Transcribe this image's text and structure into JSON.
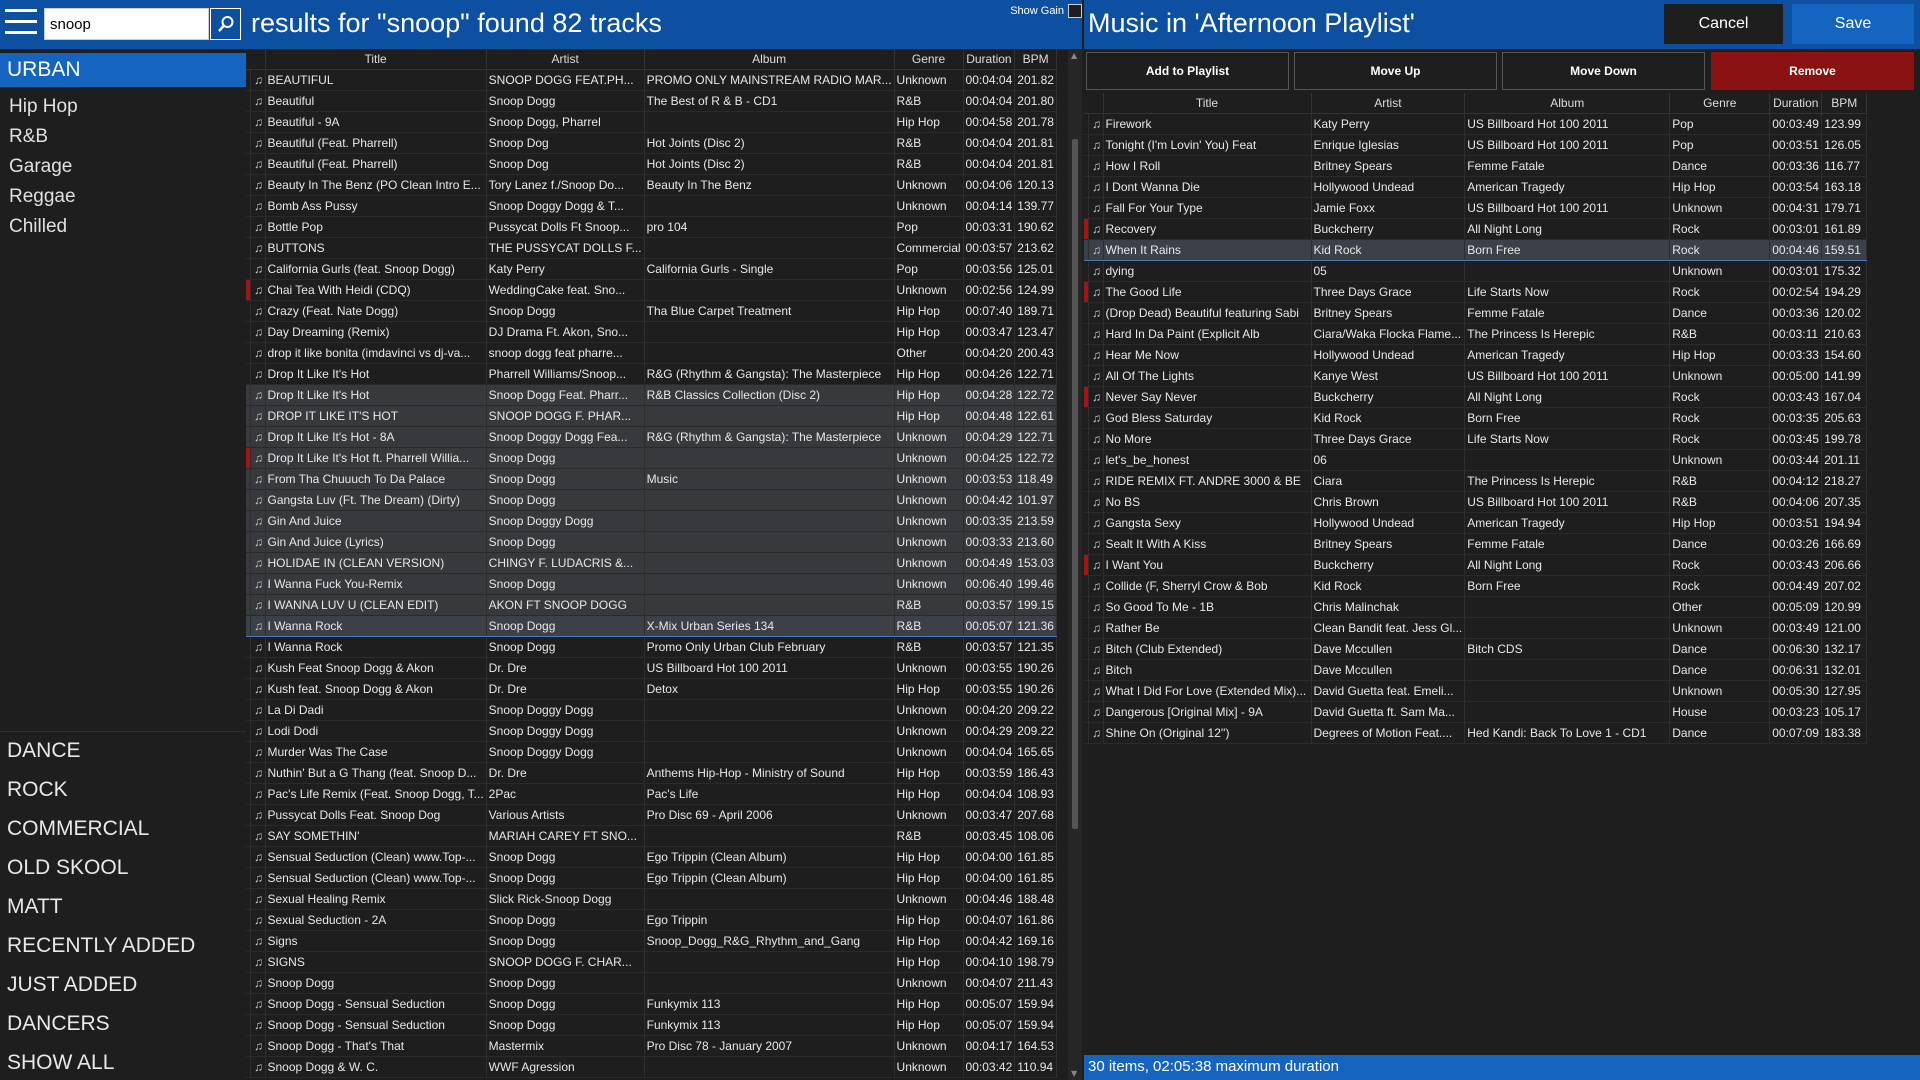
{
  "sidebar": {
    "search_value": "snoop",
    "active_category": "URBAN",
    "subcategories": [
      "Hip Hop",
      "R&B",
      "Garage",
      "Reggae",
      "Chilled"
    ],
    "bottom_categories": [
      "DANCE",
      "ROCK",
      "COMMERCIAL",
      "OLD SKOOL",
      "MATT",
      "RECENTLY ADDED",
      "JUST ADDED",
      "DANCERS",
      "SHOW ALL"
    ]
  },
  "results": {
    "title": "results for \"snoop\" found 82 tracks",
    "show_gain_label": "Show Gain",
    "columns": [
      "Title",
      "Artist",
      "Album",
      "Genre",
      "Duration",
      "BPM"
    ],
    "rows": [
      {
        "title": "BEAUTIFUL",
        "artist": "SNOOP DOGG FEAT.PH...",
        "album": "PROMO ONLY MAINSTREAM  RADIO MAR...",
        "genre": "Unknown",
        "duration": "00:04:04",
        "bpm": "201.82"
      },
      {
        "title": "Beautiful",
        "artist": "Snoop Dogg",
        "album": "The Best of R & B - CD1",
        "genre": "R&B",
        "duration": "00:04:04",
        "bpm": "201.80"
      },
      {
        "title": "Beautiful - 9A",
        "artist": "Snoop Dogg, Pharrel",
        "album": "",
        "genre": "Hip Hop",
        "duration": "00:04:58",
        "bpm": "201.78"
      },
      {
        "title": "Beautiful (Feat. Pharrell)",
        "artist": "Snoop Dog",
        "album": "Hot Joints (Disc 2)",
        "genre": "R&B",
        "duration": "00:04:04",
        "bpm": "201.81"
      },
      {
        "title": "Beautiful (Feat. Pharrell)",
        "artist": "Snoop Dog",
        "album": "Hot Joints (Disc 2)",
        "genre": "R&B",
        "duration": "00:04:04",
        "bpm": "201.81"
      },
      {
        "title": "Beauty In The Benz (PO Clean Intro E...",
        "artist": "Tory Lanez f./Snoop Do...",
        "album": "Beauty In The Benz",
        "genre": "Unknown",
        "duration": "00:04:06",
        "bpm": "120.13"
      },
      {
        "title": "Bomb Ass Pussy",
        "artist": "Snoop Doggy Dogg & T...",
        "album": "",
        "genre": "Unknown",
        "duration": "00:04:14",
        "bpm": "139.77"
      },
      {
        "title": "Bottle Pop",
        "artist": "Pussycat Dolls Ft Snoop...",
        "album": "pro 104",
        "genre": "Pop",
        "duration": "00:03:31",
        "bpm": "190.62"
      },
      {
        "title": "BUTTONS",
        "artist": "THE PUSSYCAT DOLLS F...",
        "album": "",
        "genre": "Commercial",
        "duration": "00:03:57",
        "bpm": "213.62"
      },
      {
        "title": "California Gurls (feat. Snoop Dogg)",
        "artist": "Katy Perry",
        "album": "California Gurls - Single",
        "genre": "Pop",
        "duration": "00:03:56",
        "bpm": "125.01"
      },
      {
        "title": "Chai Tea With Heidi (CDQ)",
        "artist": "WeddingCake  feat. Sno...",
        "album": "",
        "genre": "Unknown",
        "duration": "00:02:56",
        "bpm": "124.99",
        "mark": "red"
      },
      {
        "title": "Crazy (Feat. Nate Dogg)",
        "artist": "Snoop Dogg",
        "album": "Tha Blue Carpet Treatment",
        "genre": "Hip Hop",
        "duration": "00:07:40",
        "bpm": "189.71"
      },
      {
        "title": "Day Dreaming (Remix)",
        "artist": "DJ Drama  Ft. Akon, Sno...",
        "album": "",
        "genre": "Hip Hop",
        "duration": "00:03:47",
        "bpm": "123.47"
      },
      {
        "title": "drop it like bonita (imdavinci vs dj-va...",
        "artist": "snoop dogg feat pharre...",
        "album": "",
        "genre": "Other",
        "duration": "00:04:20",
        "bpm": "200.43"
      },
      {
        "title": "Drop It Like It's Hot",
        "artist": "Pharrell  Williams/Snoop...",
        "album": "R&G (Rhythm & Gangsta): The Masterpiece",
        "genre": "Hip Hop",
        "duration": "00:04:26",
        "bpm": "122.71"
      },
      {
        "title": "Drop It Like It's Hot",
        "artist": "Snoop Dogg Feat. Pharr...",
        "album": "R&B Classics Collection (Disc 2)",
        "genre": "Hip Hop",
        "duration": "00:04:28",
        "bpm": "122.72",
        "sel": true
      },
      {
        "title": "DROP IT LIKE IT'S HOT",
        "artist": "SNOOP DOGG F. PHAR...",
        "album": "",
        "genre": "Hip Hop",
        "duration": "00:04:48",
        "bpm": "122.61",
        "sel": true
      },
      {
        "title": "Drop It Like It's Hot - 8A",
        "artist": "Snoop Doggy Dogg Fea...",
        "album": "R&G (Rhythm & Gangsta): The Masterpiece",
        "genre": "Unknown",
        "duration": "00:04:29",
        "bpm": "122.71",
        "sel": true
      },
      {
        "title": "Drop It Like It's Hot ft. Pharrell Willia...",
        "artist": "Snoop Dogg",
        "album": "",
        "genre": "Unknown",
        "duration": "00:04:25",
        "bpm": "122.72",
        "sel": true,
        "mark": "red"
      },
      {
        "title": "From Tha Chuuuch To Da Palace",
        "artist": "Snoop Dogg",
        "album": "Music",
        "genre": "Unknown",
        "duration": "00:03:53",
        "bpm": "118.49",
        "sel": true
      },
      {
        "title": "Gangsta Luv (Ft. The Dream) (Dirty)",
        "artist": "Snoop Dogg",
        "album": "",
        "genre": "Unknown",
        "duration": "00:04:42",
        "bpm": "101.97",
        "sel": true
      },
      {
        "title": "Gin And Juice",
        "artist": "Snoop Doggy Dogg",
        "album": "",
        "genre": "Unknown",
        "duration": "00:03:35",
        "bpm": "213.59",
        "sel": true
      },
      {
        "title": "Gin And Juice (Lyrics)",
        "artist": "Snoop Dogg",
        "album": "",
        "genre": "Unknown",
        "duration": "00:03:33",
        "bpm": "213.60",
        "sel": true
      },
      {
        "title": "HOLIDAE IN (CLEAN VERSION)",
        "artist": "CHINGY F. LUDACRIS &...",
        "album": "",
        "genre": "Unknown",
        "duration": "00:04:49",
        "bpm": "153.03",
        "sel": true
      },
      {
        "title": "I Wanna Fuck You-Remix",
        "artist": "Snoop Dogg",
        "album": "",
        "genre": "Unknown",
        "duration": "00:06:40",
        "bpm": "199.46",
        "sel": true
      },
      {
        "title": "I WANNA LUV U (CLEAN EDIT)",
        "artist": "AKON FT SNOOP DOGG",
        "album": "",
        "genre": "R&B",
        "duration": "00:03:57",
        "bpm": "199.15",
        "sel": true
      },
      {
        "title": "I Wanna Rock",
        "artist": "Snoop Dogg",
        "album": "X-Mix Urban Series 134",
        "genre": "R&B",
        "duration": "00:05:07",
        "bpm": "121.36",
        "hl": true
      },
      {
        "title": "I Wanna Rock",
        "artist": "Snoop Dogg",
        "album": "Promo Only Urban Club February",
        "genre": "R&B",
        "duration": "00:03:57",
        "bpm": "121.35"
      },
      {
        "title": "Kush Feat Snoop Dogg & Akon",
        "artist": "Dr. Dre",
        "album": "US Billboard Hot 100 2011",
        "genre": "Unknown",
        "duration": "00:03:55",
        "bpm": "190.26"
      },
      {
        "title": "Kush feat. Snoop Dogg & Akon",
        "artist": "Dr. Dre",
        "album": "Detox",
        "genre": "Hip Hop",
        "duration": "00:03:55",
        "bpm": "190.26"
      },
      {
        "title": "La Di Dadi",
        "artist": "Snoop Doggy Dogg",
        "album": "",
        "genre": "Unknown",
        "duration": "00:04:20",
        "bpm": "209.22"
      },
      {
        "title": "Lodi Dodi",
        "artist": "Snoop Doggy Dogg",
        "album": "",
        "genre": "Unknown",
        "duration": "00:04:29",
        "bpm": "209.22"
      },
      {
        "title": "Murder Was The Case",
        "artist": "Snoop Doggy Dogg",
        "album": "",
        "genre": "Unknown",
        "duration": "00:04:04",
        "bpm": "165.65"
      },
      {
        "title": "Nuthin' But a G Thang (feat. Snoop D...",
        "artist": "Dr. Dre",
        "album": "Anthems Hip-Hop - Ministry of Sound",
        "genre": "Hip Hop",
        "duration": "00:03:59",
        "bpm": "186.43"
      },
      {
        "title": "Pac's Life Remix (Feat. Snoop Dogg, T...",
        "artist": "2Pac",
        "album": "Pac's Life",
        "genre": "Hip Hop",
        "duration": "00:04:04",
        "bpm": "108.93"
      },
      {
        "title": "Pussycat Dolls Feat. Snoop Dog",
        "artist": "Various Artists",
        "album": "Pro Disc 69 - April 2006",
        "genre": "Unknown",
        "duration": "00:03:47",
        "bpm": "207.68"
      },
      {
        "title": "SAY SOMETHIN'",
        "artist": "MARIAH CAREY FT SNO...",
        "album": "",
        "genre": "R&B",
        "duration": "00:03:45",
        "bpm": "108.06"
      },
      {
        "title": "Sensual Seduction (Clean) www.Top-...",
        "artist": "Snoop Dogg",
        "album": "Ego Trippin (Clean Album)",
        "genre": "Hip Hop",
        "duration": "00:04:00",
        "bpm": "161.85"
      },
      {
        "title": "Sensual Seduction (Clean) www.Top-...",
        "artist": "Snoop Dogg",
        "album": "Ego Trippin (Clean Album)",
        "genre": "Hip Hop",
        "duration": "00:04:00",
        "bpm": "161.85"
      },
      {
        "title": "Sexual Healing Remix",
        "artist": "Slick Rick-Snoop Dogg",
        "album": "",
        "genre": "Unknown",
        "duration": "00:04:46",
        "bpm": "188.48"
      },
      {
        "title": "Sexual Seduction - 2A",
        "artist": "Snoop Dogg",
        "album": "Ego Trippin",
        "genre": "Hip Hop",
        "duration": "00:04:07",
        "bpm": "161.86"
      },
      {
        "title": "Signs",
        "artist": "Snoop Dogg",
        "album": "Snoop_Dogg_R&G_Rhythm_and_Gang",
        "genre": "Hip Hop",
        "duration": "00:04:42",
        "bpm": "169.16"
      },
      {
        "title": "SIGNS",
        "artist": "SNOOP DOGG F. CHAR...",
        "album": "",
        "genre": "Hip Hop",
        "duration": "00:04:10",
        "bpm": "198.79"
      },
      {
        "title": "Snoop Dogg",
        "artist": "Snoop Dogg",
        "album": "",
        "genre": "Unknown",
        "duration": "00:04:07",
        "bpm": "211.43"
      },
      {
        "title": "Snoop Dogg - Sensual Seduction",
        "artist": "Snoop Dogg",
        "album": "Funkymix 113",
        "genre": "Hip Hop",
        "duration": "00:05:07",
        "bpm": "159.94"
      },
      {
        "title": "Snoop Dogg - Sensual Seduction",
        "artist": "Snoop Dogg",
        "album": "Funkymix 113",
        "genre": "Hip Hop",
        "duration": "00:05:07",
        "bpm": "159.94"
      },
      {
        "title": "Snoop Dogg - That's That",
        "artist": "Mastermix",
        "album": "Pro Disc 78 - January 2007",
        "genre": "Unknown",
        "duration": "00:04:17",
        "bpm": "164.53"
      },
      {
        "title": "Snoop Dogg & W. C.",
        "artist": "WWF Agression",
        "album": "",
        "genre": "Unknown",
        "duration": "00:03:42",
        "bpm": "110.94"
      }
    ]
  },
  "playlist": {
    "title": "Music in 'Afternoon Playlist'",
    "cancel_label": "Cancel",
    "save_label": "Save",
    "actions": {
      "add": "Add to Playlist",
      "up": "Move Up",
      "down": "Move Down",
      "remove": "Remove"
    },
    "columns": [
      "Title",
      "Artist",
      "Album",
      "Genre",
      "Duration",
      "BPM"
    ],
    "rows": [
      {
        "title": "Firework",
        "artist": "Katy Perry",
        "album": "US Billboard Hot 100 2011",
        "genre": "Pop",
        "duration": "00:03:49",
        "bpm": "123.99"
      },
      {
        "title": "Tonight (I'm Lovin' You) Feat",
        "artist": "Enrique Iglesias",
        "album": "US Billboard Hot 100 2011",
        "genre": "Pop",
        "duration": "00:03:51",
        "bpm": "126.05"
      },
      {
        "title": "How I Roll",
        "artist": "Britney Spears",
        "album": "Femme Fatale",
        "genre": "Dance",
        "duration": "00:03:36",
        "bpm": "116.77"
      },
      {
        "title": "I Dont Wanna Die",
        "artist": "Hollywood Undead",
        "album": "American Tragedy",
        "genre": "Hip Hop",
        "duration": "00:03:54",
        "bpm": "163.18"
      },
      {
        "title": "Fall For Your Type",
        "artist": "Jamie Foxx",
        "album": "US Billboard Hot 100 2011",
        "genre": "Unknown",
        "duration": "00:04:31",
        "bpm": "179.71"
      },
      {
        "title": "Recovery",
        "artist": "Buckcherry",
        "album": "All Night Long",
        "genre": "Rock",
        "duration": "00:03:01",
        "bpm": "161.89",
        "mark": "red"
      },
      {
        "title": "When It Rains",
        "artist": "Kid Rock",
        "album": "Born Free",
        "genre": "Rock",
        "duration": "00:04:46",
        "bpm": "159.51",
        "hl": true
      },
      {
        "title": "dying",
        "artist": "05",
        "album": "",
        "genre": "Unknown",
        "duration": "00:03:01",
        "bpm": "175.32"
      },
      {
        "title": "The Good Life",
        "artist": "Three Days Grace",
        "album": "Life Starts Now",
        "genre": "Rock",
        "duration": "00:02:54",
        "bpm": "194.29",
        "mark": "red"
      },
      {
        "title": "(Drop Dead) Beautiful featuring Sabi",
        "artist": "Britney Spears",
        "album": "Femme Fatale",
        "genre": "Dance",
        "duration": "00:03:36",
        "bpm": "120.02"
      },
      {
        "title": "Hard In Da Paint (Explicit Alb",
        "artist": "Ciara/Waka Flocka Flame...",
        "album": "The Princess Is Herepic",
        "genre": "R&B",
        "duration": "00:03:11",
        "bpm": "210.63"
      },
      {
        "title": "Hear Me Now",
        "artist": "Hollywood Undead",
        "album": "American Tragedy",
        "genre": "Hip Hop",
        "duration": "00:03:33",
        "bpm": "154.60"
      },
      {
        "title": "All Of The Lights",
        "artist": "Kanye West",
        "album": "US Billboard Hot 100 2011",
        "genre": "Unknown",
        "duration": "00:05:00",
        "bpm": "141.99"
      },
      {
        "title": "Never Say Never",
        "artist": "Buckcherry",
        "album": "All Night Long",
        "genre": "Rock",
        "duration": "00:03:43",
        "bpm": "167.04",
        "mark": "red"
      },
      {
        "title": "God Bless Saturday",
        "artist": "Kid Rock",
        "album": "Born Free",
        "genre": "Rock",
        "duration": "00:03:35",
        "bpm": "205.63"
      },
      {
        "title": "No More",
        "artist": "Three Days Grace",
        "album": "Life Starts Now",
        "genre": "Rock",
        "duration": "00:03:45",
        "bpm": "199.78"
      },
      {
        "title": "let's_be_honest",
        "artist": "06",
        "album": "",
        "genre": "Unknown",
        "duration": "00:03:44",
        "bpm": "201.11"
      },
      {
        "title": "RIDE REMIX FT. ANDRE 3000 & BE",
        "artist": "Ciara",
        "album": "The Princess Is Herepic",
        "genre": "R&B",
        "duration": "00:04:12",
        "bpm": "218.27"
      },
      {
        "title": "No BS",
        "artist": "Chris Brown",
        "album": "US Billboard Hot 100 2011",
        "genre": "R&B",
        "duration": "00:04:06",
        "bpm": "207.35"
      },
      {
        "title": "Gangsta Sexy",
        "artist": "Hollywood Undead",
        "album": "American Tragedy",
        "genre": "Hip Hop",
        "duration": "00:03:51",
        "bpm": "194.94"
      },
      {
        "title": "Sealt It With A Kiss",
        "artist": "Britney Spears",
        "album": "Femme Fatale",
        "genre": "Dance",
        "duration": "00:03:26",
        "bpm": "166.69"
      },
      {
        "title": "I Want You",
        "artist": "Buckcherry",
        "album": "All Night Long",
        "genre": "Rock",
        "duration": "00:03:43",
        "bpm": "206.66",
        "mark": "red"
      },
      {
        "title": "Collide (F, Sherryl Crow & Bob",
        "artist": "Kid Rock",
        "album": "Born Free",
        "genre": "Rock",
        "duration": "00:04:49",
        "bpm": "207.02"
      },
      {
        "title": "So Good To Me - 1B",
        "artist": "Chris Malinchak",
        "album": "",
        "genre": "Other",
        "duration": "00:05:09",
        "bpm": "120.99"
      },
      {
        "title": "Rather Be",
        "artist": "Clean Bandit feat. Jess Gl...",
        "album": "",
        "genre": "Unknown",
        "duration": "00:03:49",
        "bpm": "121.00"
      },
      {
        "title": "Bitch (Club Extended)",
        "artist": "Dave Mccullen",
        "album": "Bitch CDS",
        "genre": "Dance",
        "duration": "00:06:30",
        "bpm": "132.17"
      },
      {
        "title": "Bitch",
        "artist": "Dave Mccullen",
        "album": "",
        "genre": "Dance",
        "duration": "00:06:31",
        "bpm": "132.01"
      },
      {
        "title": "What I Did For Love (Extended Mix)...",
        "artist": "David Guetta feat. Emeli...",
        "album": "",
        "genre": "Unknown",
        "duration": "00:05:30",
        "bpm": "127.95"
      },
      {
        "title": "Dangerous [Original Mix] - 9A",
        "artist": "David Guetta ft. Sam Ma...",
        "album": "",
        "genre": "House",
        "duration": "00:03:23",
        "bpm": "105.17"
      },
      {
        "title": "Shine On (Original 12'')",
        "artist": "Degrees of Motion Feat....",
        "album": "Hed Kandi: Back To Love 1 - CD1",
        "genre": "Dance",
        "duration": "00:07:09",
        "bpm": "183.38"
      }
    ],
    "status": "30 items, 02:05:38 maximum duration"
  }
}
